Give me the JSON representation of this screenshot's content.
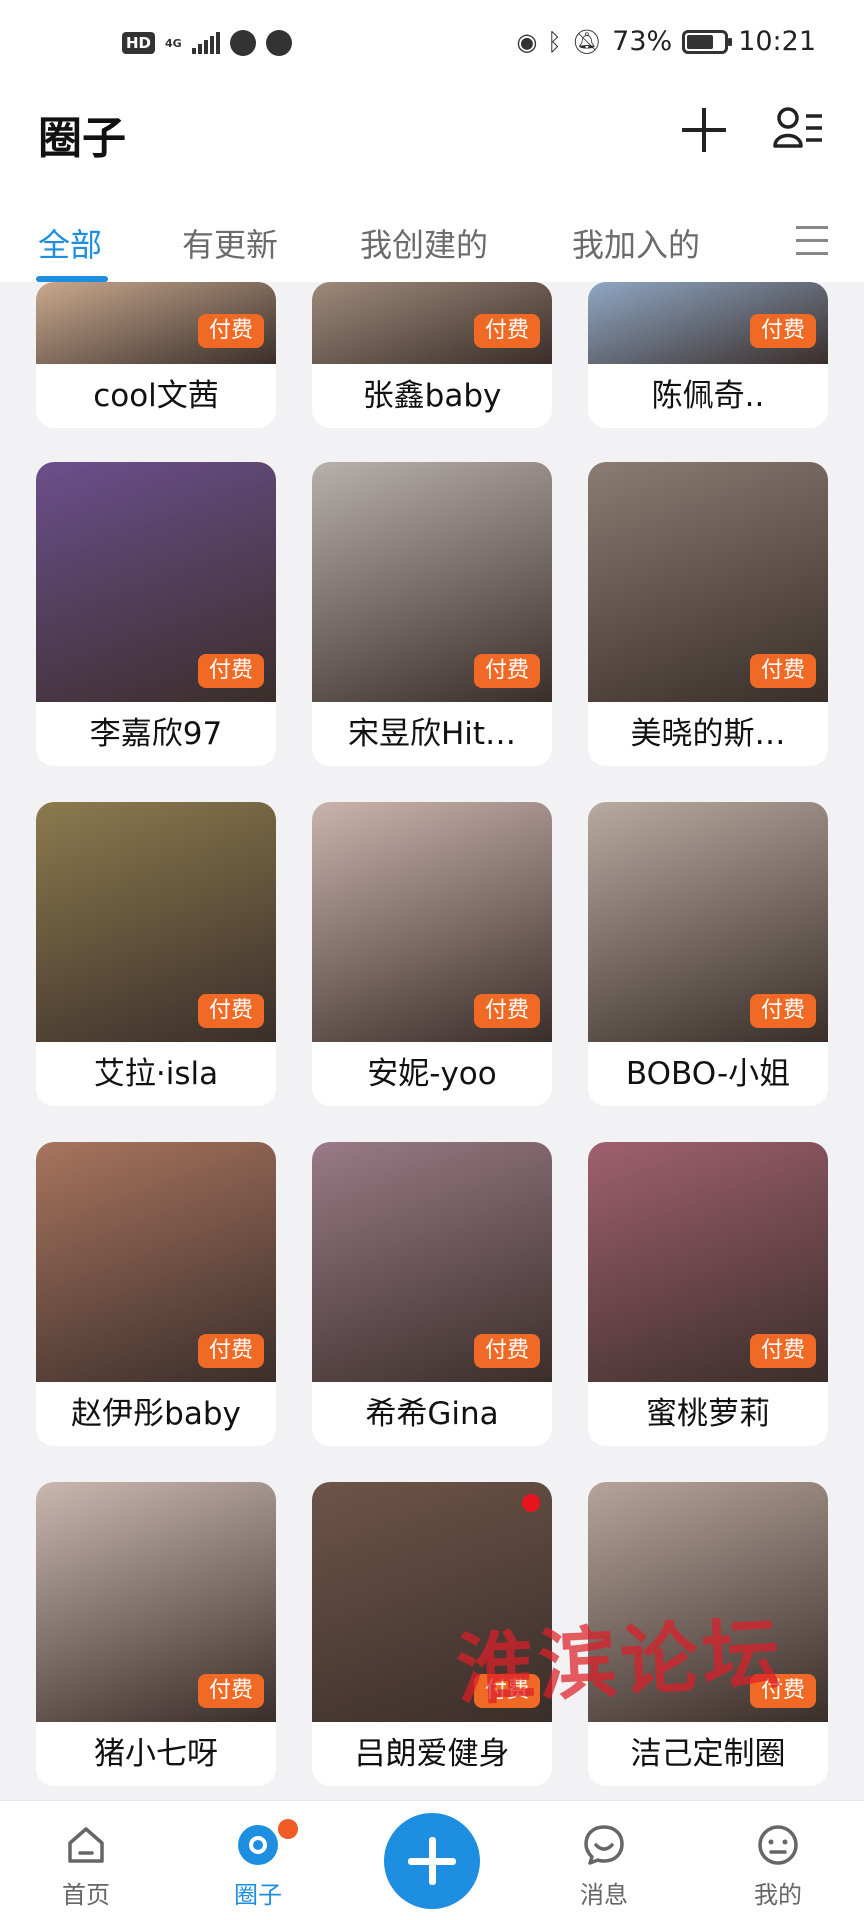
{
  "status_bar": {
    "hd": "HD",
    "network": "4G",
    "battery_pct": "73%",
    "battery_level": 0.73,
    "time": "10:21",
    "icons": [
      "signal-icon",
      "qq-icon",
      "sports-ball-icon",
      "eye-icon",
      "bluetooth-icon",
      "mute-bell-icon",
      "battery-icon"
    ]
  },
  "header": {
    "title": "圈子"
  },
  "tabs": [
    {
      "label": "全部",
      "active": true
    },
    {
      "label": "有更新",
      "active": false
    },
    {
      "label": "我创建的",
      "active": false
    },
    {
      "label": "我加入的",
      "active": false
    }
  ],
  "badge_label": "付费",
  "cards": [
    {
      "name": "cool文茜",
      "paid": true,
      "color": "#c9a98e"
    },
    {
      "name": "张鑫baby",
      "paid": true,
      "color": "#9e8a7a"
    },
    {
      "name": "陈佩奇..",
      "paid": true,
      "color": "#8fa7c4"
    },
    {
      "name": "李嘉欣97",
      "paid": true,
      "color": "#6b4f8c"
    },
    {
      "name": "宋昱欣Hit…",
      "paid": true,
      "color": "#b8b0ad"
    },
    {
      "name": "美晓的斯…",
      "paid": true,
      "color": "#8a7c72"
    },
    {
      "name": "艾拉·isla",
      "paid": true,
      "color": "#8c7a4e"
    },
    {
      "name": "安妮-yoo",
      "paid": true,
      "color": "#cbb3ad"
    },
    {
      "name": "BOBO-小姐",
      "paid": true,
      "color": "#b7aaa0"
    },
    {
      "name": "赵伊彤baby",
      "paid": true,
      "color": "#a8745e"
    },
    {
      "name": "希希Gina",
      "paid": true,
      "color": "#9a7a86"
    },
    {
      "name": "蜜桃萝莉",
      "paid": true,
      "color": "#a06070"
    },
    {
      "name": "猪小七呀",
      "paid": true,
      "color": "#c9b8b0"
    },
    {
      "name": "吕朗爱健身",
      "paid": true,
      "color": "#6e5448",
      "unread": true
    },
    {
      "name": "洁己定制圈",
      "paid": true,
      "color": "#b5a49a"
    }
  ],
  "watermark": "淮滨论坛",
  "bottom_nav": [
    {
      "label": "首页",
      "icon": "home-icon"
    },
    {
      "label": "圈子",
      "icon": "circle-icon",
      "active": true
    },
    {
      "label": "消息",
      "icon": "message-icon"
    },
    {
      "label": "我的",
      "icon": "profile-icon"
    }
  ],
  "colors": {
    "accent": "#1e8fe0",
    "badge": "#f06a25",
    "notification": "#e8141d"
  }
}
